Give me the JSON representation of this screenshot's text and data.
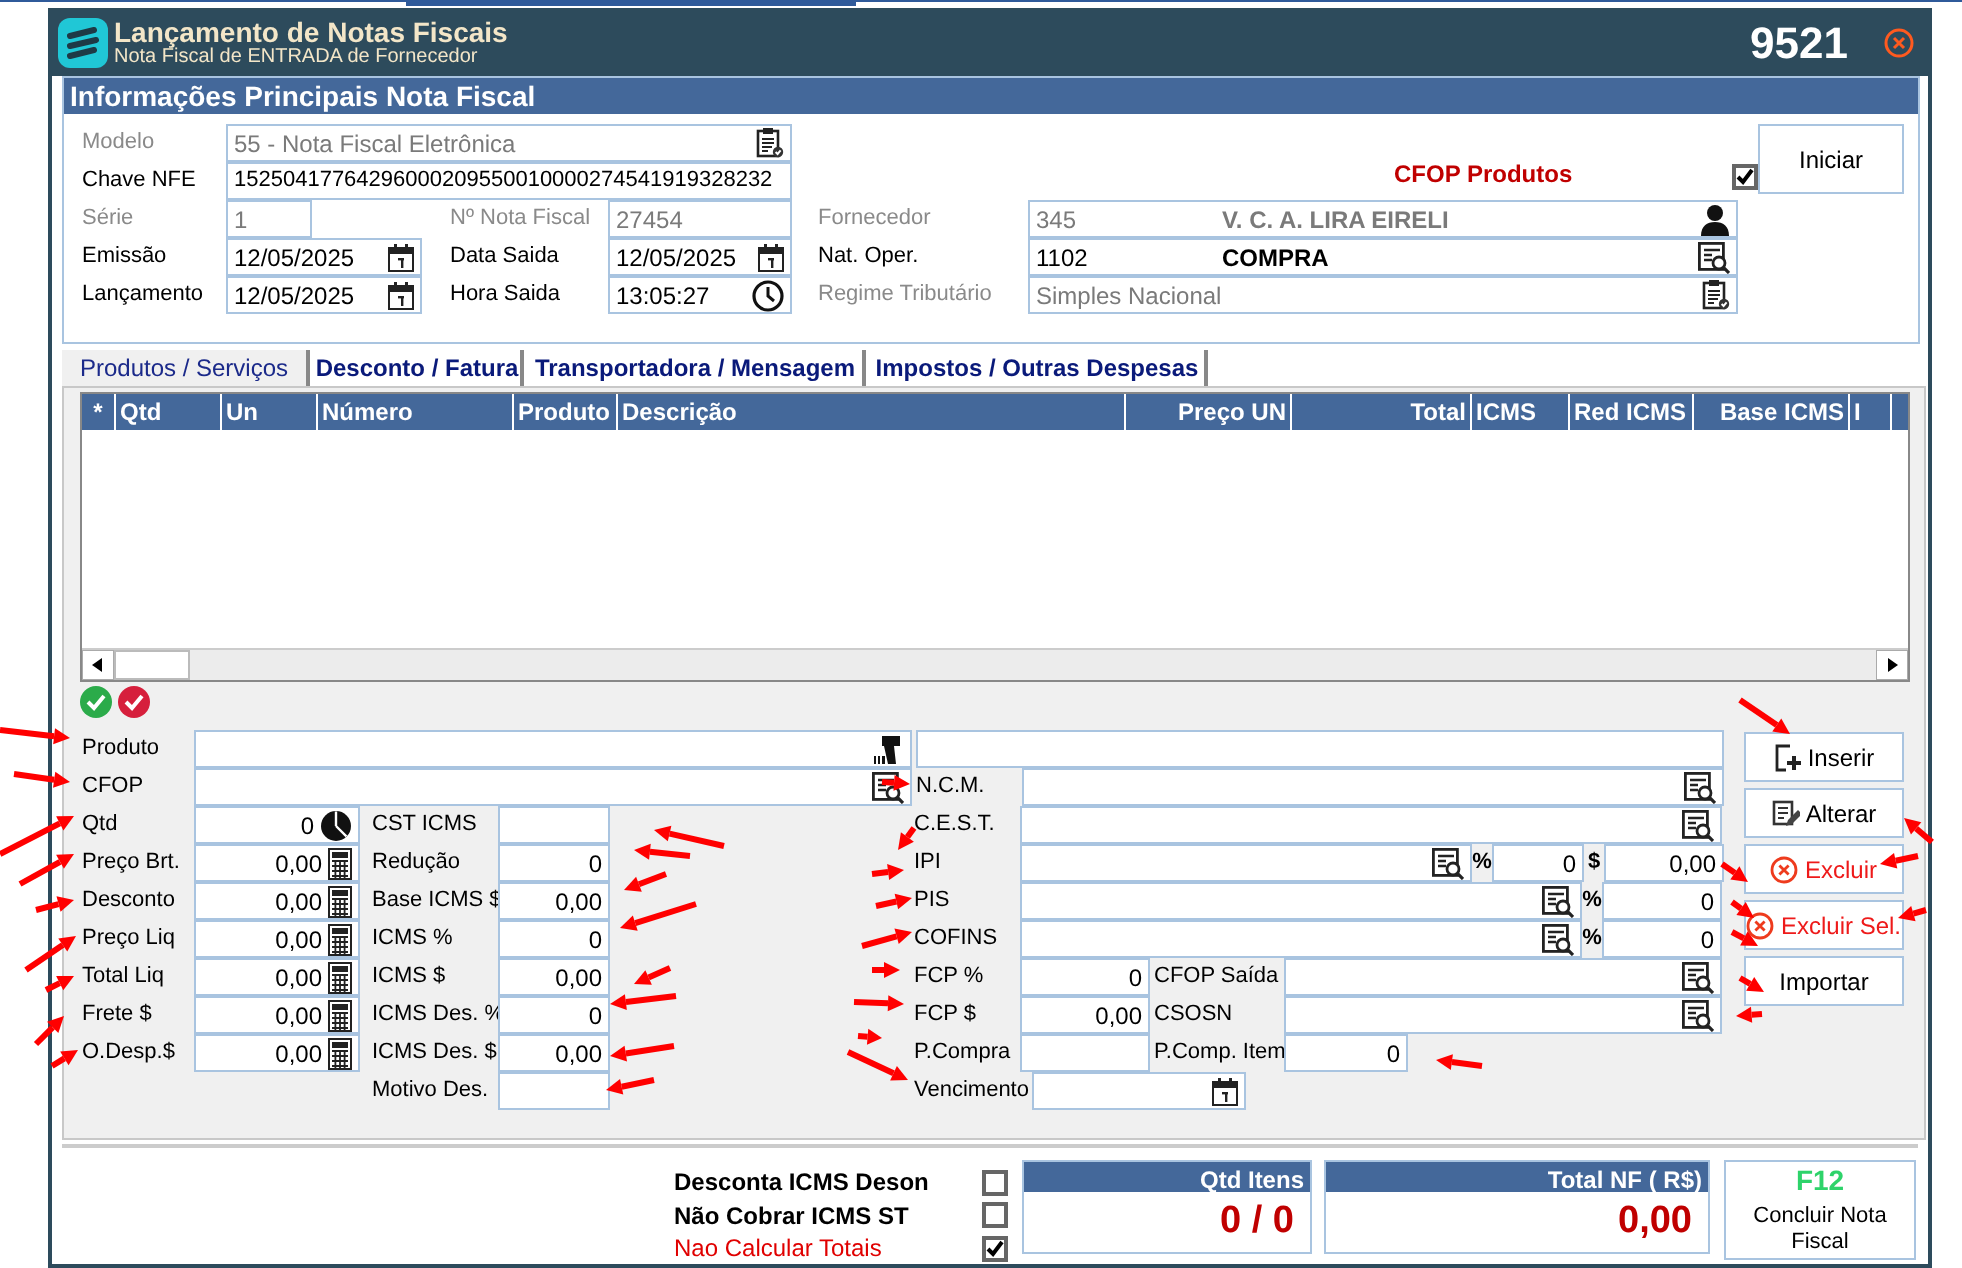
{
  "window": {
    "title": "Lançamento de Notas Fiscais",
    "subtitle": "Nota Fiscal de ENTRADA de Fornecedor",
    "number": "9521"
  },
  "main_info": {
    "title": "Informações Principais Nota Fiscal",
    "modelo": {
      "label": "Modelo",
      "value": "55 - Nota Fiscal Eletrônica",
      "disabled": true
    },
    "chave_nfe": {
      "label": "Chave NFE",
      "value": "15250417764296000209550010000274541919328232",
      "disabled": false
    },
    "serie": {
      "label": "Série",
      "value": "1",
      "disabled": true
    },
    "nota_fiscal": {
      "label": "Nº Nota Fiscal",
      "value": "27454",
      "disabled": true
    },
    "emissao": {
      "label": "Emissão",
      "value": "12/05/2025",
      "disabled": false
    },
    "data_saida": {
      "label": "Data Saida",
      "value": "12/05/2025",
      "disabled": false
    },
    "lancamento": {
      "label": "Lançamento",
      "value": "12/05/2025",
      "disabled": false
    },
    "hora_saida": {
      "label": "Hora Saida",
      "value": "13:05:27",
      "disabled": false
    },
    "fornecedor": {
      "label": "Fornecedor",
      "code": "345",
      "name": "V. C. A. LIRA EIRELI",
      "disabled": true
    },
    "nat_oper": {
      "label": "Nat. Oper.",
      "code": "1102",
      "name": "COMPRA",
      "disabled": false
    },
    "regime": {
      "label": "Regime Tributário",
      "value": "Simples Nacional",
      "disabled": true
    },
    "cfop_produtos": {
      "label": "CFOP Produtos",
      "checked": true
    },
    "start_button": "Iniciar"
  },
  "tabs": [
    {
      "label": "Produtos / Serviços",
      "selected": true
    },
    {
      "label": "Desconto / Fatura",
      "selected": false
    },
    {
      "label": "Transportadora / Mensagem",
      "selected": false
    },
    {
      "label": "Impostos / Outras Despesas",
      "selected": false
    }
  ],
  "table": {
    "columns": [
      "*",
      "Qtd",
      "Un",
      "Número",
      "Produto",
      "Descrição",
      "Preço UN",
      "Total",
      "ICMS",
      "Red ICMS",
      "Base ICMS",
      "I"
    ]
  },
  "item_form": {
    "produto": {
      "label": "Produto"
    },
    "cfop": {
      "label": "CFOP"
    },
    "ncm": {
      "label": "N.C.M."
    },
    "amounts": [
      {
        "label": "Qtd",
        "value": "0",
        "kind": "count"
      },
      {
        "label": "Preço Brt.",
        "value": "0,00",
        "kind": "money"
      },
      {
        "label": "Desconto",
        "value": "0,00",
        "kind": "money"
      },
      {
        "label": "Preço Liq",
        "value": "0,00",
        "kind": "money"
      },
      {
        "label": "Total Liq",
        "value": "0,00",
        "kind": "money"
      },
      {
        "label": "Frete $",
        "value": "0,00",
        "kind": "money"
      },
      {
        "label": "O.Desp.$",
        "value": "0,00",
        "kind": "money"
      }
    ],
    "icms": [
      {
        "label": "CST ICMS"
      },
      {
        "label": "Redução",
        "value": "0"
      },
      {
        "label": "Base ICMS $",
        "value": "0,00"
      },
      {
        "label": "ICMS %",
        "value": "0"
      },
      {
        "label": "ICMS $",
        "value": "0,00"
      },
      {
        "label": "ICMS Des. %",
        "value": "0"
      },
      {
        "label": "ICMS Des. $",
        "value": "0,00"
      },
      {
        "label": "Motivo Des."
      }
    ],
    "cest": {
      "label": "C.E.S.T."
    },
    "ipi": {
      "label": "IPI",
      "percent_sign": "%",
      "percent": "0",
      "amount_sign": "$",
      "amount": "0,00"
    },
    "pis": {
      "label": "PIS",
      "percent_sign": "%",
      "percent": "0"
    },
    "cofins": {
      "label": "COFINS",
      "percent_sign": "%",
      "percent": "0"
    },
    "fcp_percent": {
      "label": "FCP %",
      "value": "0"
    },
    "cfop_saida": {
      "label": "CFOP Saída"
    },
    "fcp_amount": {
      "label": "FCP $",
      "value": "0,00"
    },
    "csosn": {
      "label": "CSOSN"
    },
    "p_compra": {
      "label": "P.Compra"
    },
    "p_comp_item": {
      "label": "P.Comp. Item",
      "value": "0"
    },
    "vencimento": {
      "label": "Vencimento"
    }
  },
  "actions": [
    {
      "label": "Inserir",
      "kind": "insert"
    },
    {
      "label": "Alterar",
      "kind": "edit"
    },
    {
      "label": "Excluir",
      "kind": "delete"
    },
    {
      "label": "Excluir Sel.",
      "kind": "delete"
    },
    {
      "label": "Importar",
      "kind": "import"
    }
  ],
  "options": [
    {
      "label": "Desconta ICMS Deson",
      "checked": false,
      "kind": "normal"
    },
    {
      "label": "Não Cobrar ICMS ST",
      "checked": false,
      "kind": "normal"
    },
    {
      "label": "Nao Calcular Totais",
      "checked": true,
      "kind": "alert"
    }
  ],
  "totals": [
    {
      "label": "Qtd Itens",
      "value": "0 / 0"
    },
    {
      "label": "Total NF ( R$)",
      "value": "0,00"
    }
  ],
  "finish_button": {
    "shortcut": "F12",
    "label": "Concluir Nota Fiscal"
  }
}
